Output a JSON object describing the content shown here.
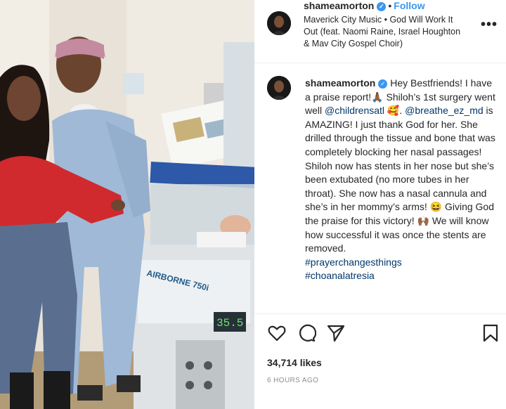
{
  "post": {
    "username": "shameamorton",
    "follow_label": "Follow",
    "music": "Maverick City Music • God Will Work It Out (feat. Naomi Raine, Israel Houghton & Mav City Gospel Choir)",
    "more_label": "•••",
    "caption": {
      "t1": " Hey Bestfriends! I have a praise report!🙏🏾 Shiloh’s 1st surgery went well ",
      "m1": "@childrensatl",
      "t2": " 🥰. ",
      "m2": "@breathe_ez_md",
      "t3": " is AMAZING! I just thank God for her. She drilled through the tissue and bone that was completely blocking her nasal passages! Shiloh now has stents in her nose but she’s been extubated (no more tubes in her throat). She now has a nasal cannula and she’s in her mommy’s arms! 😆 Giving God the praise for this victory! 🙌🏾 We will know how successful it was once the stents are removed.",
      "h1": "#prayerchangesthings",
      "h2": "#choanalatresia"
    },
    "likes": "34,714 likes",
    "time": "6 HOURS AGO"
  },
  "photo": {
    "incubator_brand": "AIRBORNE 750i",
    "monitor_reading": "35.5"
  },
  "colors": {
    "link": "#00376b",
    "follow": "#3897f0",
    "muted": "#8e8e8e"
  },
  "icons": [
    "heart-icon",
    "comment-icon",
    "share-icon",
    "bookmark-icon",
    "verified-badge-icon",
    "more-options-icon"
  ]
}
